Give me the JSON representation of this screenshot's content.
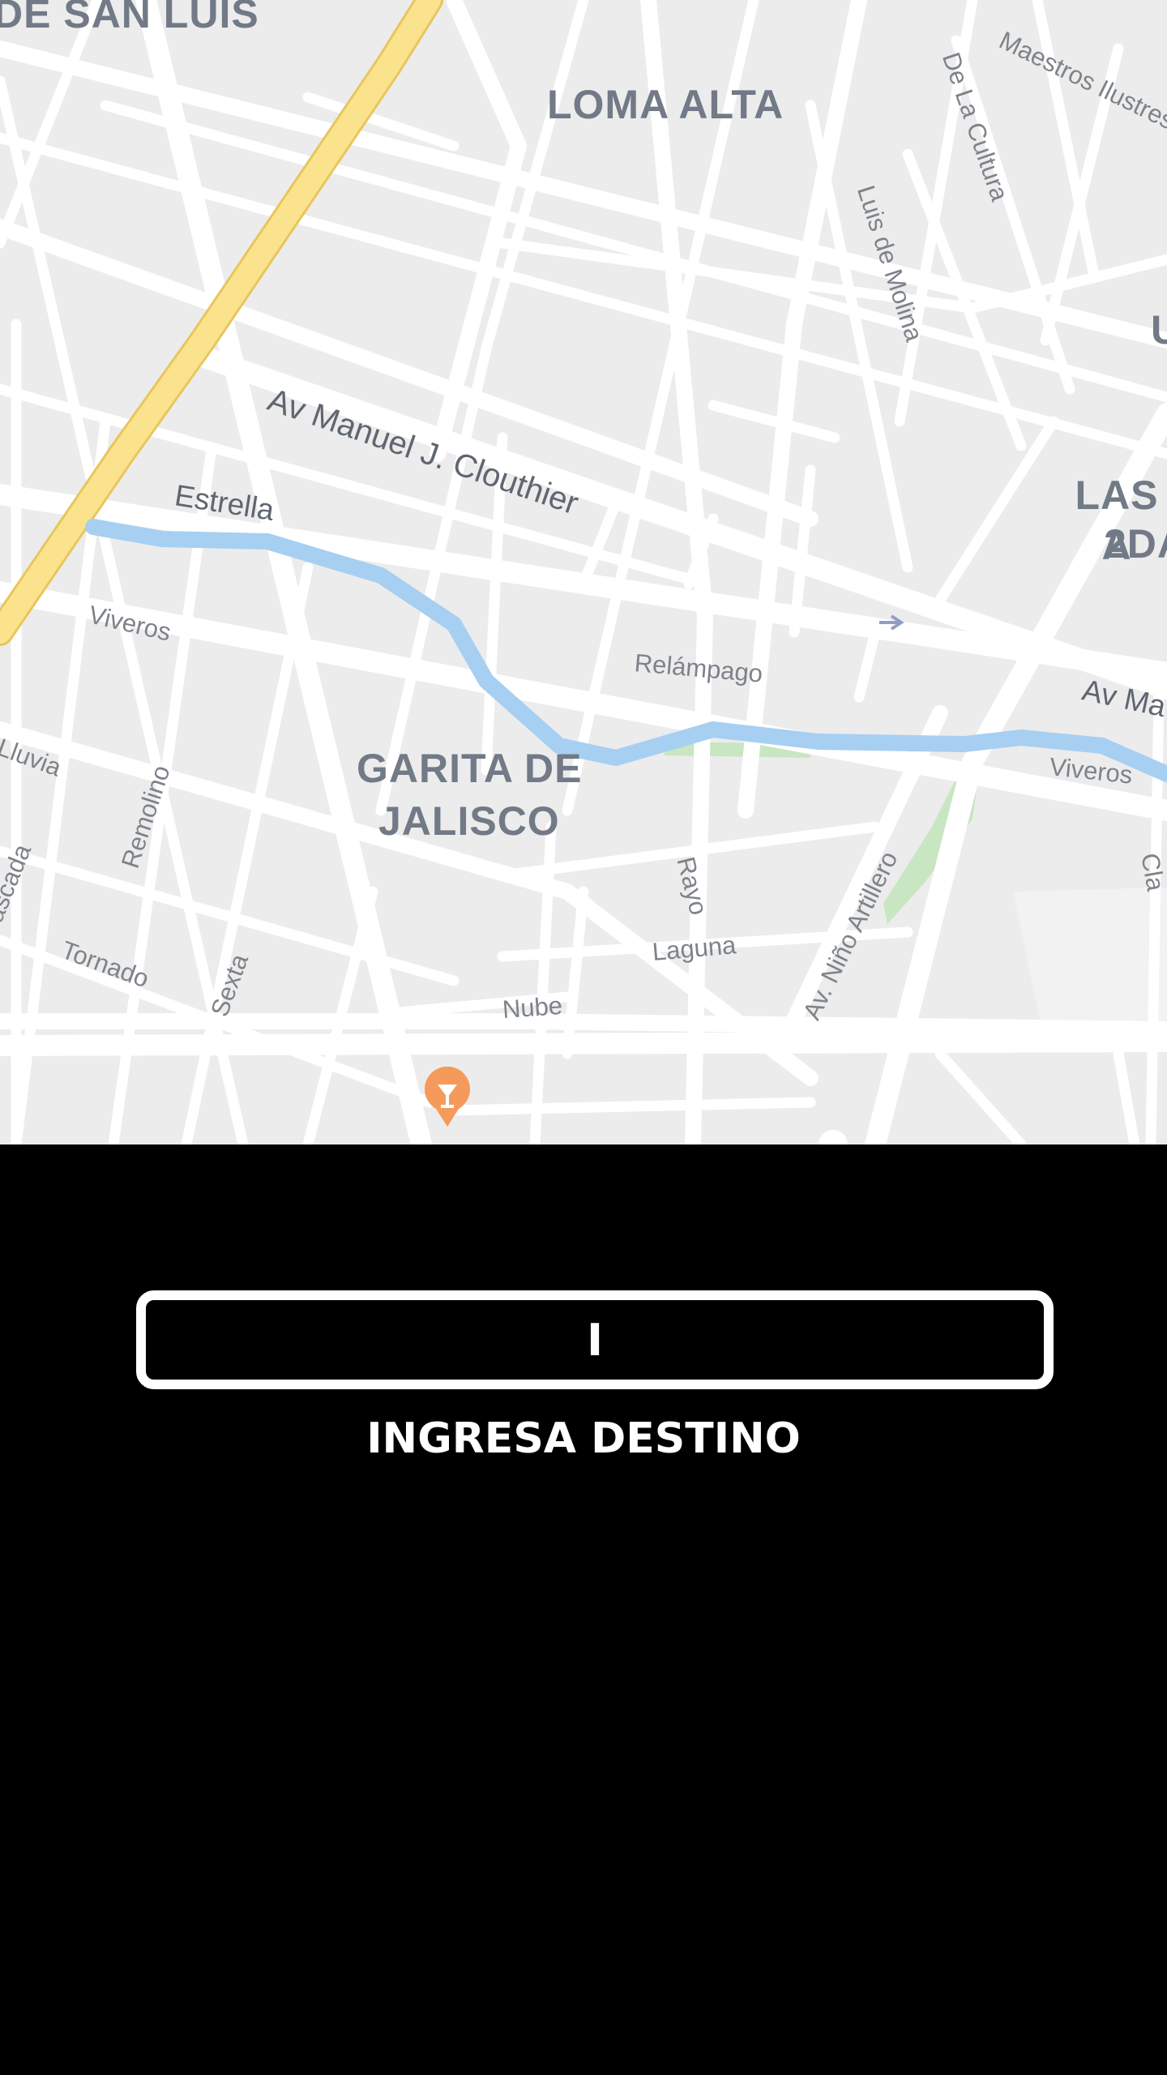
{
  "map": {
    "areas": {
      "san_luis": "DE SAN LUIS",
      "loma_alta": "LOMA ALTA",
      "las_2da_line1": "LAS A",
      "las_2da_line2": "2DA",
      "u_partial": "U",
      "garita_line1": "GARITA DE",
      "garita_line2": "JALISCO"
    },
    "streets": {
      "maestros": "Maestros Ilustres",
      "la_cultura": "De La Cultura",
      "luis_de_molina": "Luis de Molina",
      "clouthier": "Av Manuel J. Clouthier",
      "estrella": "Estrella",
      "viveros_left": "Viveros",
      "relampago": "Relámpago",
      "av_ma": "Av Ma",
      "lluvia": "Lluvia",
      "remolino": "Remolino",
      "cascada": "ascada",
      "tornado": "Tornado",
      "sexta": "Sexta",
      "nube": "Nube",
      "laguna": "Laguna",
      "rayo": "Rayo",
      "nino_artillero": "Av. Niño Artillero",
      "viveros_right": "Viveros",
      "right_edge": "Cla"
    },
    "poi_icon": "cocktail-bar-pin-icon",
    "colors": {
      "land": "#ececec",
      "road": "#ffffff",
      "highway": "#fbe38e",
      "river": "#a6cff2",
      "park": "#c7e6c1",
      "poi": "#f59a5b"
    }
  },
  "destination": {
    "input_value": "I",
    "label": "INGRESA DESTINO"
  }
}
